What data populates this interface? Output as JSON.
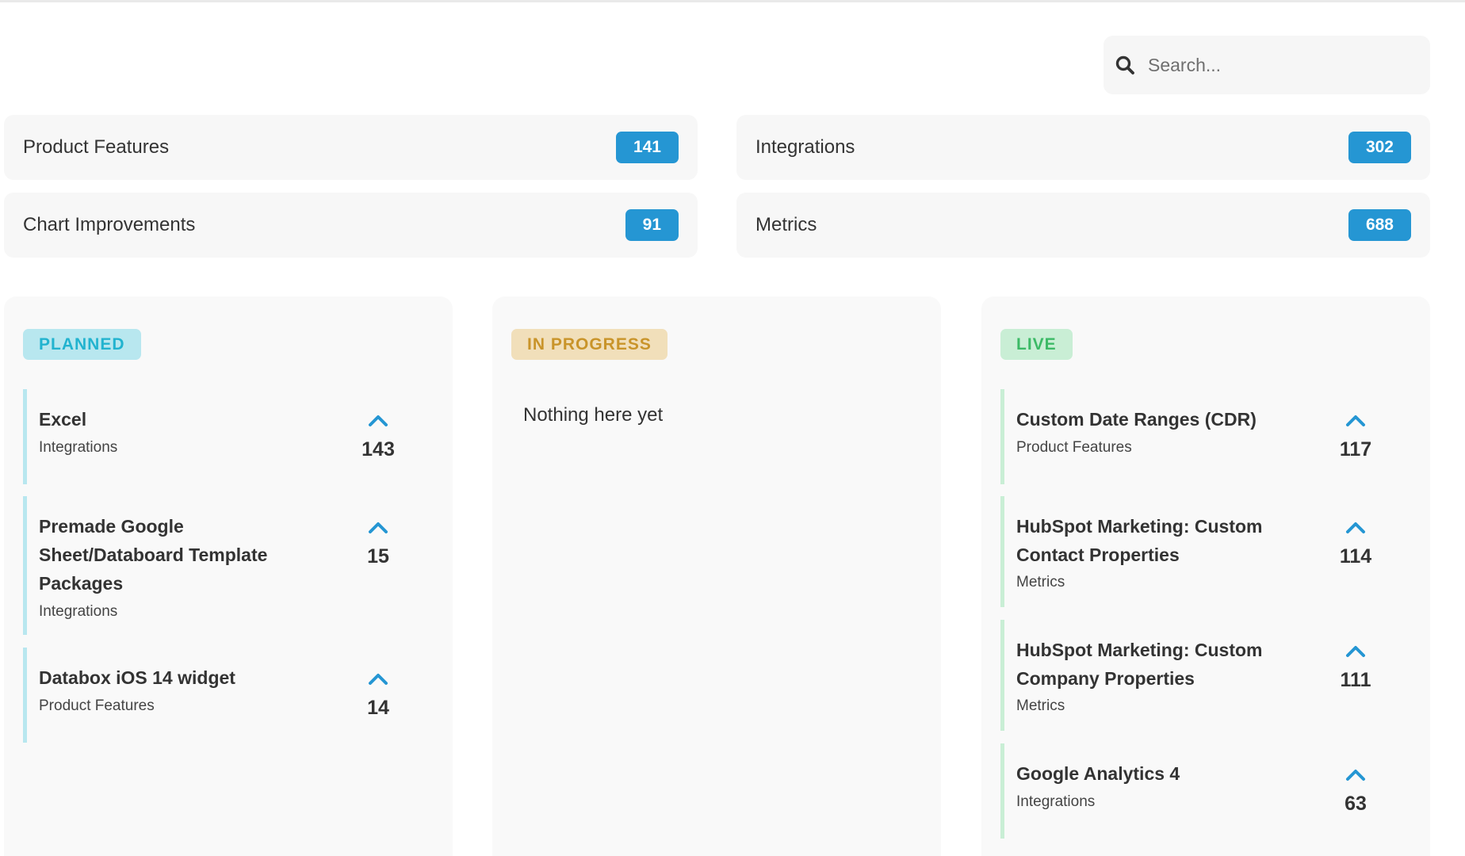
{
  "search": {
    "placeholder": "Search..."
  },
  "categories": [
    {
      "name": "Product Features",
      "count": "141"
    },
    {
      "name": "Integrations",
      "count": "302"
    },
    {
      "name": "Chart Improvements",
      "count": "91"
    },
    {
      "name": "Metrics",
      "count": "688"
    }
  ],
  "columns": {
    "planned": {
      "label": "PLANNED",
      "items": [
        {
          "title": "Excel",
          "category": "Integrations",
          "votes": "143"
        },
        {
          "title": "Premade Google Sheet/Databoard Template Packages",
          "category": "Integrations",
          "votes": "15"
        },
        {
          "title": "Databox iOS 14 widget",
          "category": "Product Features",
          "votes": "14"
        }
      ]
    },
    "in_progress": {
      "label": "IN PROGRESS",
      "empty_text": "Nothing here yet"
    },
    "live": {
      "label": "LIVE",
      "items": [
        {
          "title": "Custom Date Ranges (CDR)",
          "category": "Product Features",
          "votes": "117"
        },
        {
          "title": "HubSpot Marketing: Custom Contact Properties",
          "category": "Metrics",
          "votes": "114"
        },
        {
          "title": "HubSpot Marketing: Custom Company Properties",
          "category": "Metrics",
          "votes": "111"
        },
        {
          "title": "Google Analytics 4",
          "category": "Integrations",
          "votes": "63"
        }
      ]
    }
  },
  "colors": {
    "accent": "#2596d3",
    "planned": "#22b3cf",
    "in_progress": "#c9942a",
    "live": "#3cba66"
  }
}
